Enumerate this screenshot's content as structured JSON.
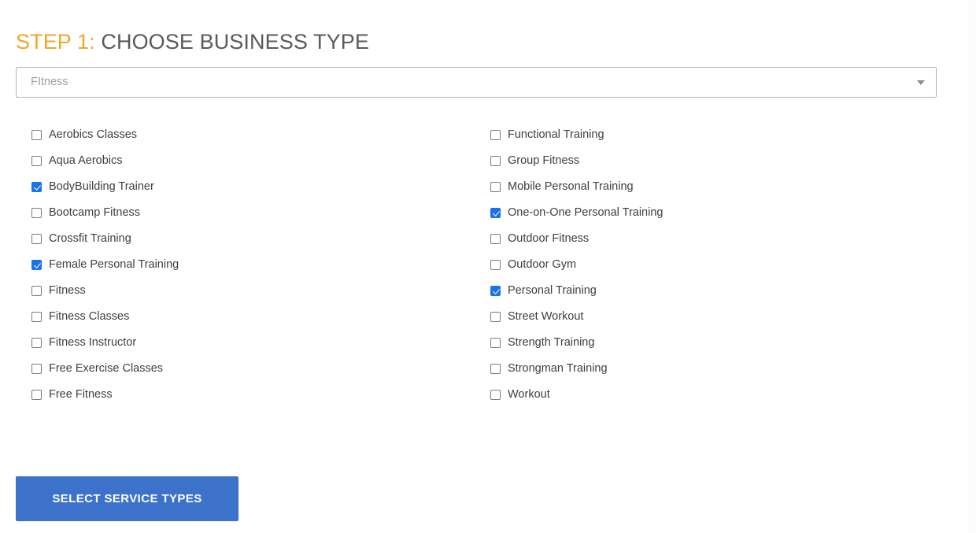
{
  "heading": {
    "prefix": "STEP 1:",
    "title": "CHOOSE BUSINESS TYPE",
    "prefix_color": "#f1a627",
    "title_color": "#5a5a5a"
  },
  "business_type_select": {
    "value": "FItness",
    "placeholder": "FItness",
    "arrow_icon": "chevron-down-icon"
  },
  "service_types": {
    "left_column": [
      {
        "label": "Aerobics Classes",
        "checked": false
      },
      {
        "label": "Aqua Aerobics",
        "checked": false
      },
      {
        "label": "BodyBuilding Trainer",
        "checked": true
      },
      {
        "label": "Bootcamp Fitness",
        "checked": false
      },
      {
        "label": "Crossfit Training",
        "checked": false
      },
      {
        "label": "Female Personal Training",
        "checked": true
      },
      {
        "label": "Fitness",
        "checked": false
      },
      {
        "label": "Fitness Classes",
        "checked": false
      },
      {
        "label": "Fitness Instructor",
        "checked": false
      },
      {
        "label": "Free Exercise Classes",
        "checked": false
      },
      {
        "label": "Free Fitness",
        "checked": false
      }
    ],
    "right_column": [
      {
        "label": "Functional Training",
        "checked": false
      },
      {
        "label": "Group Fitness",
        "checked": false
      },
      {
        "label": "Mobile Personal Training",
        "checked": false
      },
      {
        "label": "One-on-One Personal Training",
        "checked": true
      },
      {
        "label": "Outdoor Fitness",
        "checked": false
      },
      {
        "label": "Outdoor Gym",
        "checked": false
      },
      {
        "label": "Personal Training",
        "checked": true
      },
      {
        "label": "Street Workout",
        "checked": false
      },
      {
        "label": "Strength Training",
        "checked": false
      },
      {
        "label": "Strongman Training",
        "checked": false
      },
      {
        "label": "Workout",
        "checked": false
      }
    ]
  },
  "submit_button": {
    "label": "Select Service Types",
    "color": "#3d72ca",
    "text_color": "#ffffff"
  },
  "colors": {
    "accent_blue": "#1a73e8",
    "button_blue": "#3d72ca",
    "step_orange": "#f1a627",
    "text": "#3c4043",
    "muted_text": "#9aa0a6",
    "border": "#b0b3b8",
    "background": "#ffffff"
  }
}
